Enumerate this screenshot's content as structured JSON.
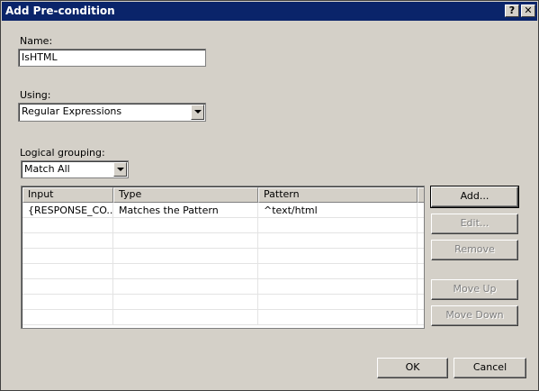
{
  "window": {
    "title": "Add Pre-condition",
    "help_glyph": "?",
    "close_glyph": "✕"
  },
  "form": {
    "name_label": "Name:",
    "name_value": "IsHTML",
    "using_label": "Using:",
    "using_value": "Regular Expressions",
    "grouping_label": "Logical grouping:",
    "grouping_value": "Match All"
  },
  "grid": {
    "columns": [
      "Input",
      "Type",
      "Pattern"
    ],
    "rows": [
      [
        "{RESPONSE_CO...",
        "Matches the Pattern",
        "^text/html"
      ]
    ]
  },
  "buttons": {
    "add": "Add...",
    "edit": "Edit...",
    "remove": "Remove",
    "move_up": "Move Up",
    "move_down": "Move Down",
    "ok": "OK",
    "cancel": "Cancel"
  }
}
